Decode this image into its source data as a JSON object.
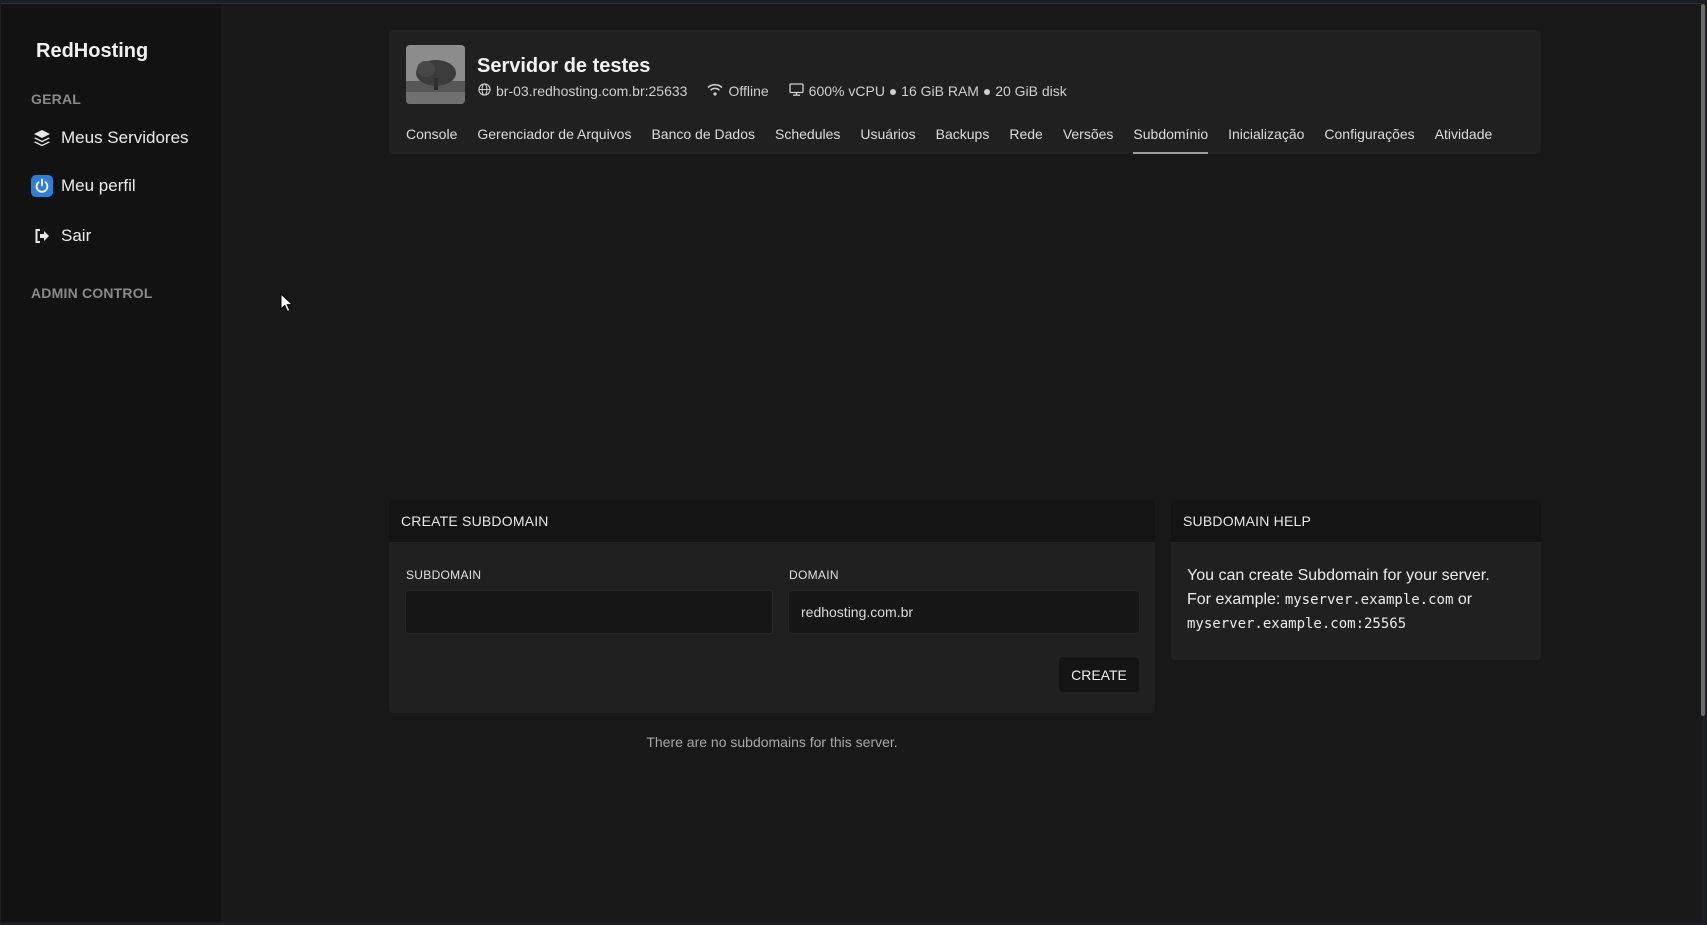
{
  "sidebar": {
    "brand": "RedHosting",
    "section_general": "GERAL",
    "items": [
      {
        "label": "Meus Servidores",
        "icon": "layers-icon"
      },
      {
        "label": "Meu perfil",
        "icon": "power-icon"
      },
      {
        "label": "Sair",
        "icon": "sign-out-icon"
      }
    ],
    "section_admin": "ADMIN CONTROL"
  },
  "server": {
    "name": "Servidor de testes",
    "address": "br-03.redhosting.com.br:25633",
    "status": "Offline",
    "resources": "600% vCPU ● 16 GiB RAM ● 20 GiB disk"
  },
  "tabs": [
    {
      "label": "Console"
    },
    {
      "label": "Gerenciador de Arquivos"
    },
    {
      "label": "Banco de Dados"
    },
    {
      "label": "Schedules"
    },
    {
      "label": "Usuários"
    },
    {
      "label": "Backups"
    },
    {
      "label": "Rede"
    },
    {
      "label": "Versões"
    },
    {
      "label": "Subdomínio",
      "active": true
    },
    {
      "label": "Inicialização"
    },
    {
      "label": "Configurações"
    },
    {
      "label": "Atividade"
    }
  ],
  "create": {
    "title": "CREATE SUBDOMAIN",
    "subdomain_label": "SUBDOMAIN",
    "subdomain_value": "",
    "domain_label": "DOMAIN",
    "domain_value": "redhosting.com.br",
    "button": "CREATE"
  },
  "help": {
    "title": "SUBDOMAIN HELP",
    "line1": "You can create Subdomain for your server.",
    "line2_prefix": "For example: ",
    "example1": "myserver.example.com",
    "or": " or",
    "example2": "myserver.example.com:25565"
  },
  "empty_message": "There are no subdomains for this server.",
  "colors": {
    "accent_power": "#2f7fd8",
    "background": "#181818",
    "sidebar": "#121212"
  }
}
